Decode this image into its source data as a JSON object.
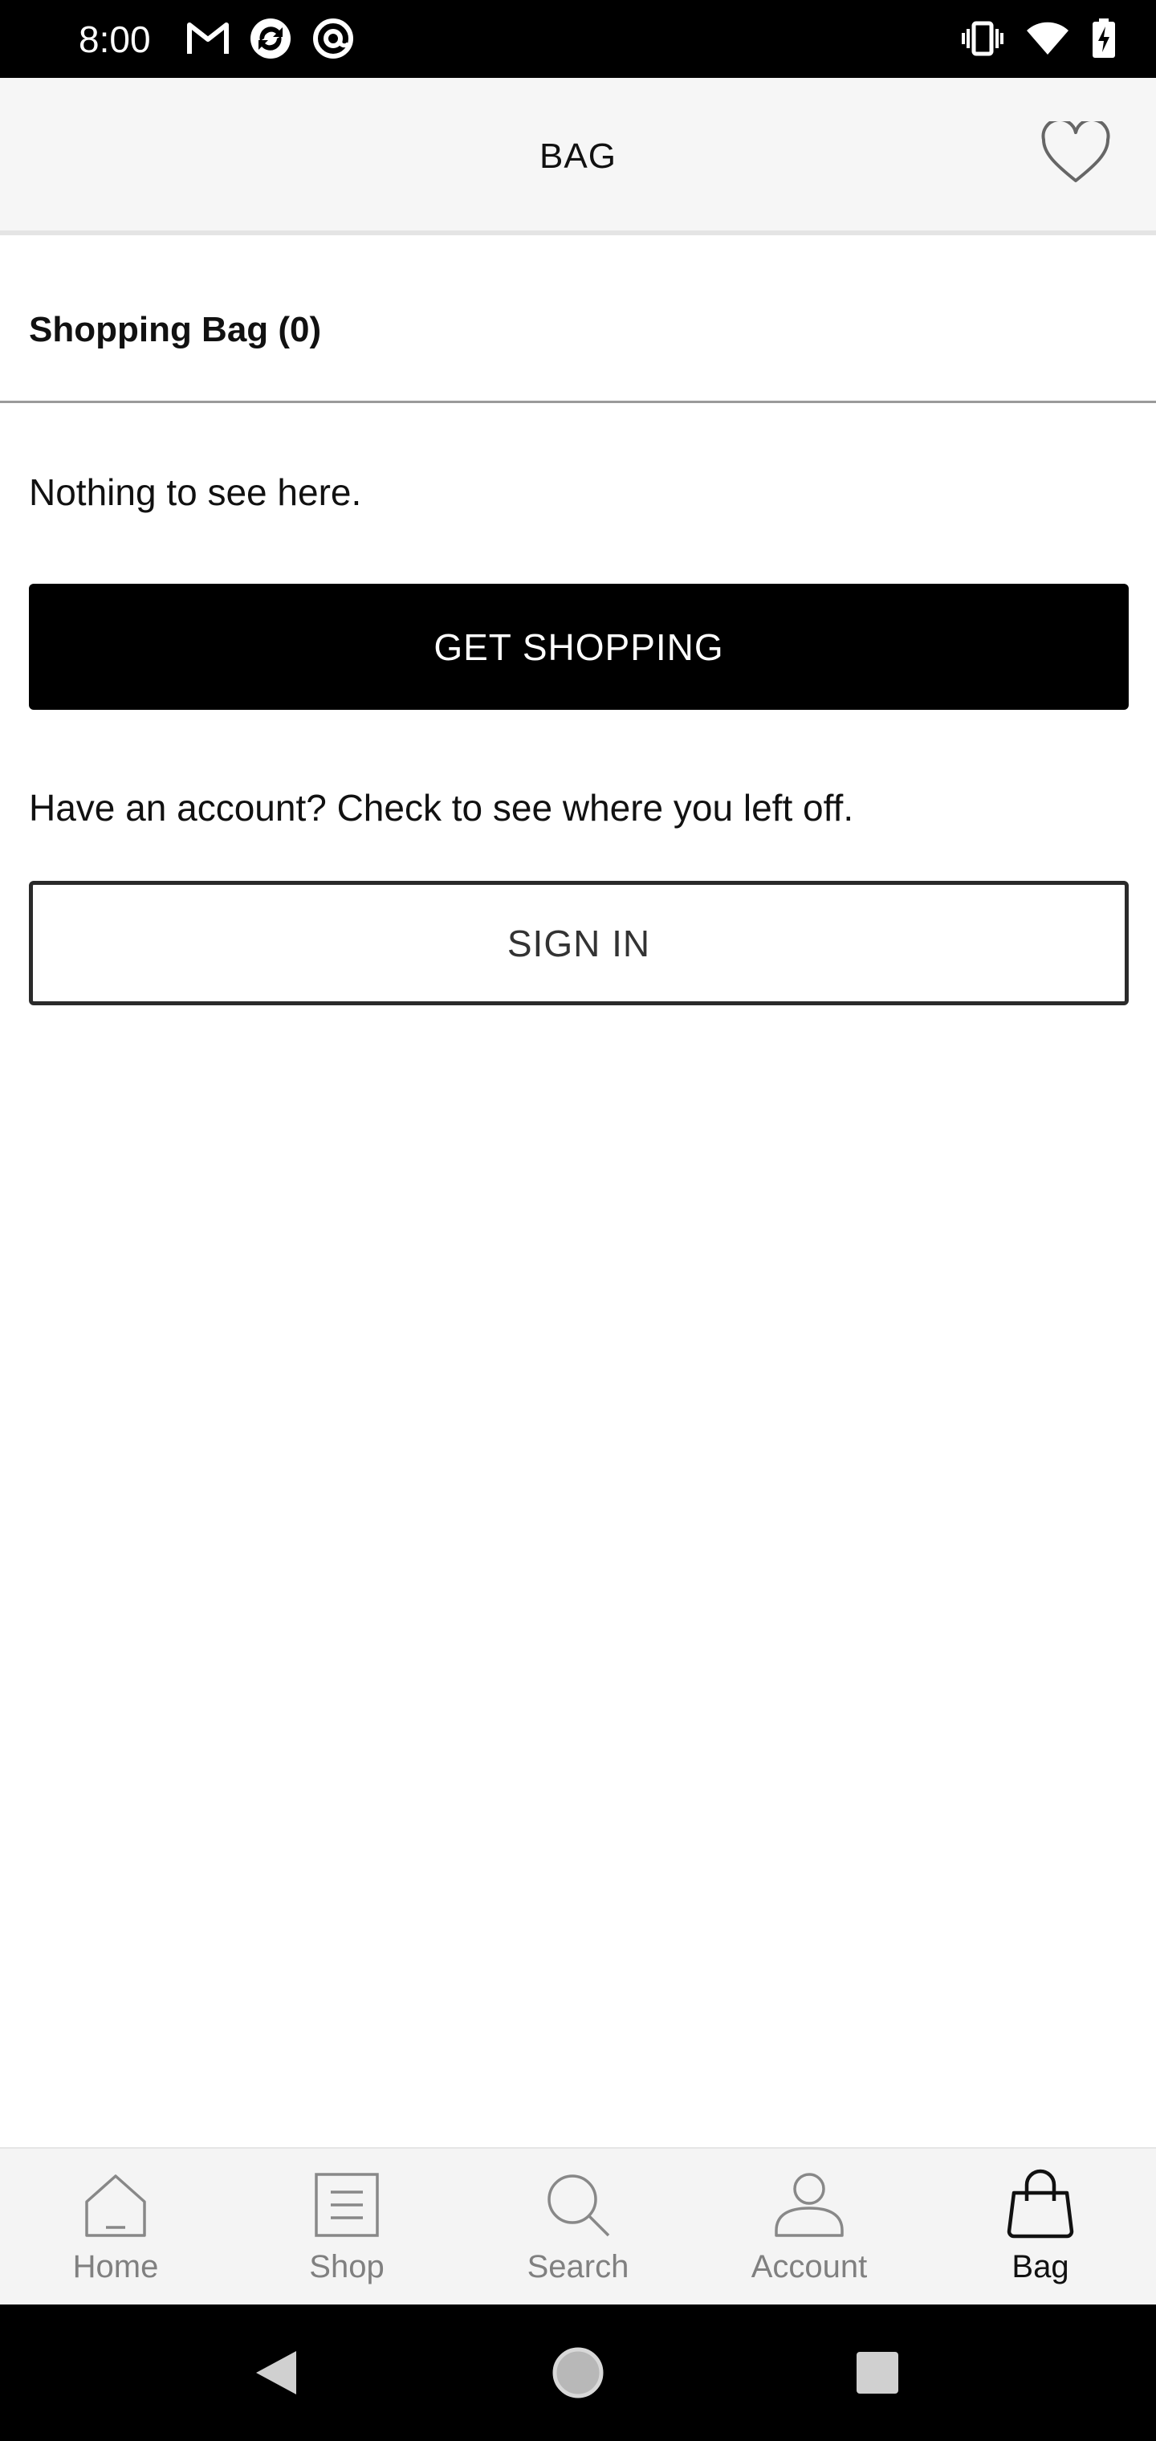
{
  "status_bar": {
    "time": "8:00",
    "left_icons": [
      "gmail-icon",
      "sync-app-icon",
      "at-app-icon"
    ],
    "right_icons": [
      "vibrate-icon",
      "wifi-icon",
      "battery-charging-icon"
    ]
  },
  "header": {
    "title": "BAG",
    "wishlist_icon": "heart-icon"
  },
  "bag": {
    "heading": "Shopping Bag (0)",
    "empty_message": "Nothing to see here.",
    "get_shopping_label": "GET SHOPPING",
    "account_message": "Have an account? Check to see where you left off.",
    "sign_in_label": "SIGN IN"
  },
  "bottom_nav": {
    "items": [
      {
        "label": "Home",
        "icon": "home-icon",
        "active": false
      },
      {
        "label": "Shop",
        "icon": "list-icon",
        "active": false
      },
      {
        "label": "Search",
        "icon": "search-icon",
        "active": false
      },
      {
        "label": "Account",
        "icon": "person-icon",
        "active": false
      },
      {
        "label": "Bag",
        "icon": "bag-icon",
        "active": true
      }
    ]
  },
  "system_nav": {
    "buttons": [
      "back-icon",
      "home-circle-icon",
      "recents-square-icon"
    ]
  },
  "colors": {
    "accent": "#000000",
    "header_bg": "#f6f6f6",
    "nav_inactive": "#808080",
    "nav_active": "#111111"
  }
}
